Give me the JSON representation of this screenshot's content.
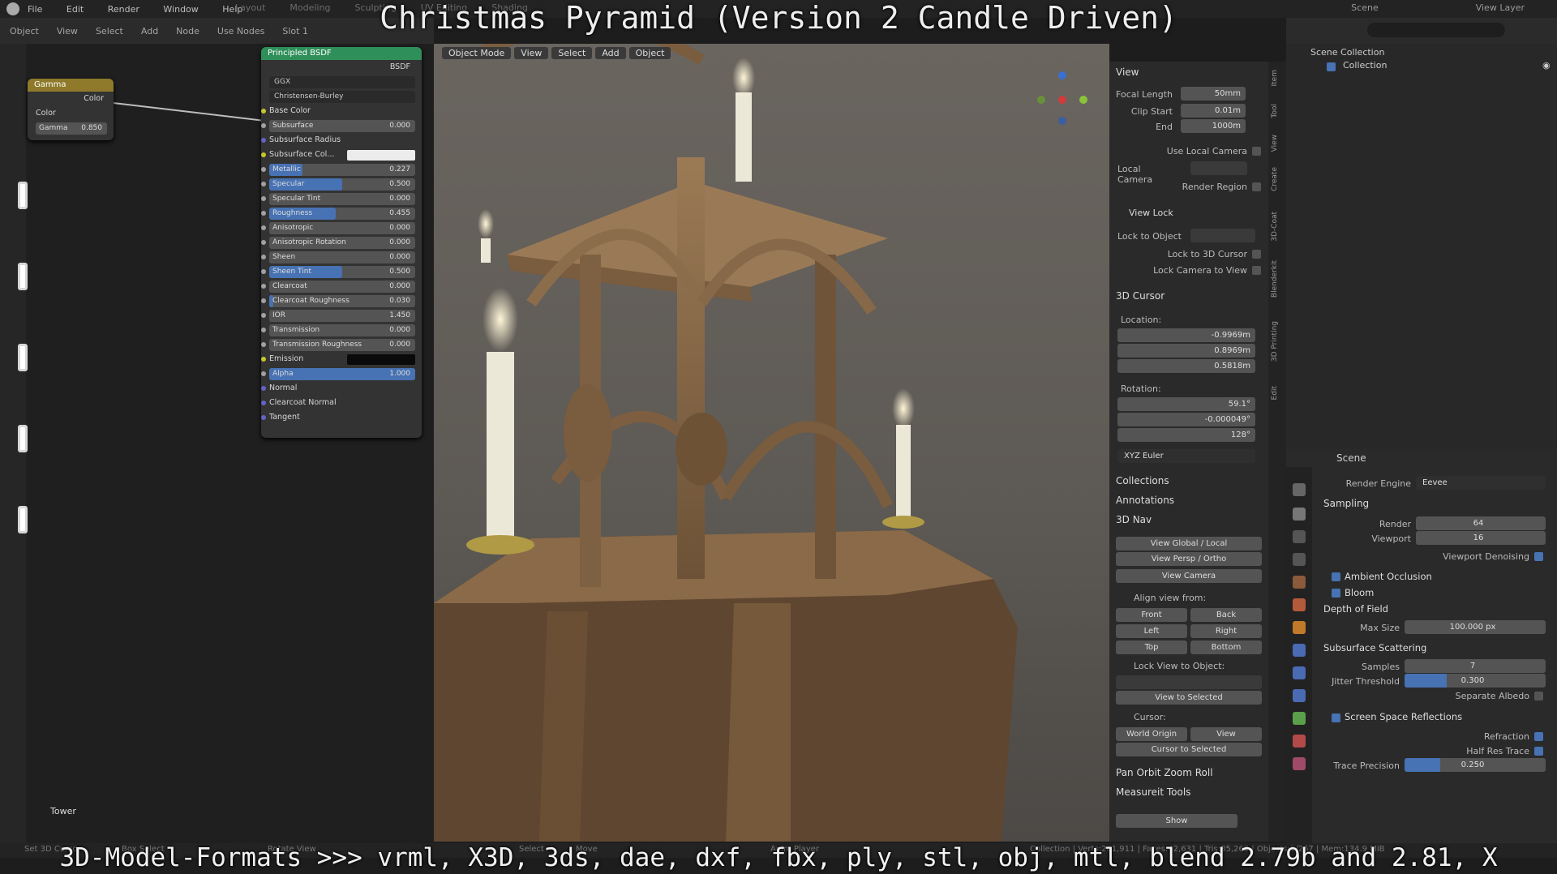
{
  "title_overlay": "Christmas Pyramid (Version 2 Candle Driven)",
  "subtitle_overlay": "3D-Model-Formats >>> vrml, X3D, 3ds, dae, dxf, fbx, ply, stl, obj, mtl, blend 2.79b and 2.81, X",
  "topbar": {
    "menu": [
      "File",
      "Edit",
      "Render",
      "Window",
      "Help"
    ],
    "workspaces": [
      "Layout",
      "Modeling",
      "Sculpting",
      "UV Editing",
      "Shading"
    ],
    "scene": "Scene",
    "view_layer": "View Layer"
  },
  "node_header": {
    "items": [
      "Object",
      "View",
      "Select",
      "Add",
      "Node"
    ],
    "use_nodes": "Use Nodes",
    "slot": "Slot 1"
  },
  "gamma_node": {
    "title": "Gamma",
    "out_label": "Color",
    "in_label": "Color",
    "field_label": "Gamma",
    "field_value": "0.850"
  },
  "bsdf_node": {
    "title": "Principled BSDF",
    "output": "BSDF",
    "distribution": "GGX",
    "subsurface_method": "Christensen-Burley",
    "rows": [
      {
        "label": "Base Color",
        "value": "",
        "kind": "plain",
        "sock": "yellow"
      },
      {
        "label": "Subsurface",
        "value": "0.000",
        "kind": "slider",
        "fill": 0,
        "sock": "grey"
      },
      {
        "label": "Subsurface Radius",
        "value": "",
        "kind": "dropdown",
        "sock": "blue"
      },
      {
        "label": "Subsurface Col...",
        "value": "",
        "kind": "color",
        "color": "#ececec",
        "sock": "yellow"
      },
      {
        "label": "Metallic",
        "value": "0.227",
        "kind": "slider",
        "fill": 0.227,
        "sock": "grey"
      },
      {
        "label": "Specular",
        "value": "0.500",
        "kind": "slider",
        "fill": 0.5,
        "sock": "grey"
      },
      {
        "label": "Specular Tint",
        "value": "0.000",
        "kind": "slider",
        "fill": 0,
        "sock": "grey"
      },
      {
        "label": "Roughness",
        "value": "0.455",
        "kind": "slider",
        "fill": 0.455,
        "sock": "grey"
      },
      {
        "label": "Anisotropic",
        "value": "0.000",
        "kind": "slider",
        "fill": 0,
        "sock": "grey"
      },
      {
        "label": "Anisotropic Rotation",
        "value": "0.000",
        "kind": "slider",
        "fill": 0,
        "sock": "grey"
      },
      {
        "label": "Sheen",
        "value": "0.000",
        "kind": "slider",
        "fill": 0,
        "sock": "grey"
      },
      {
        "label": "Sheen Tint",
        "value": "0.500",
        "kind": "slider",
        "fill": 0.5,
        "sock": "grey"
      },
      {
        "label": "Clearcoat",
        "value": "0.000",
        "kind": "slider",
        "fill": 0,
        "sock": "grey"
      },
      {
        "label": "Clearcoat Roughness",
        "value": "0.030",
        "kind": "slider",
        "fill": 0.03,
        "sock": "grey"
      },
      {
        "label": "IOR",
        "value": "1.450",
        "kind": "slider",
        "fill": 0,
        "sock": "grey"
      },
      {
        "label": "Transmission",
        "value": "0.000",
        "kind": "slider",
        "fill": 0,
        "sock": "grey"
      },
      {
        "label": "Transmission Roughness",
        "value": "0.000",
        "kind": "slider",
        "fill": 0,
        "sock": "grey"
      },
      {
        "label": "Emission",
        "value": "",
        "kind": "color",
        "color": "#0a0a0a",
        "sock": "yellow"
      },
      {
        "label": "Alpha",
        "value": "1.000",
        "kind": "slider",
        "fill": 1,
        "sock": "grey"
      },
      {
        "label": "Normal",
        "value": "",
        "kind": "plain",
        "sock": "blue"
      },
      {
        "label": "Clearcoat Normal",
        "value": "",
        "kind": "plain",
        "sock": "blue"
      },
      {
        "label": "Tangent",
        "value": "",
        "kind": "plain",
        "sock": "blue"
      }
    ]
  },
  "tower_label": "Tower",
  "viewport_header": [
    "Object Mode",
    "View",
    "Select",
    "Add",
    "Object"
  ],
  "npanel": {
    "view_title": "View",
    "focal_label": "Focal Length",
    "focal_value": "50mm",
    "clip_start_label": "Clip Start",
    "clip_start_value": "0.01m",
    "end_label": "End",
    "end_value": "1000m",
    "use_local_camera": "Use Local Camera",
    "local_camera": "Local Camera",
    "render_region": "Render Region",
    "view_lock_title": "View Lock",
    "lock_to_object": "Lock to Object",
    "lock_to_cursor": "Lock to 3D Cursor",
    "lock_camera": "Lock Camera to View",
    "cursor_title": "3D Cursor",
    "location_label": "Location:",
    "loc_x": "-0.9969m",
    "loc_y": "0.8969m",
    "loc_z": "0.5818m",
    "rotation_label": "Rotation:",
    "rot_x": "59.1°",
    "rot_y": "-0.000049°",
    "rot_z": "128°",
    "rot_mode": "XYZ Euler",
    "collections": "Collections",
    "annotations": "Annotations",
    "nav_title": "3D Nav",
    "view_global_local": "View Global / Local",
    "view_persp_ortho": "View Persp / Ortho",
    "view_camera": "View Camera",
    "align_view": "Align view from:",
    "front": "Front",
    "back": "Back",
    "left": "Left",
    "right": "Right",
    "top": "Top",
    "bottom": "Bottom",
    "lock_view": "Lock View to Object:",
    "view_selected": "View to Selected",
    "cursor_label": "Cursor:",
    "world_origin": "World Origin",
    "view": "View",
    "cursor_selected": "Cursor to Selected",
    "pan_orbit": "Pan Orbit Zoom Roll",
    "measureit": "Measureit Tools",
    "show": "Show",
    "tabs": [
      "Item",
      "Tool",
      "View",
      "Create",
      "3D-Coat",
      "Blenderkit",
      "3D Printing",
      "Edit"
    ]
  },
  "outliner": {
    "scene_collection": "Scene Collection",
    "collection": "Collection"
  },
  "properties": {
    "scene": "Scene",
    "render_engine_label": "Render Engine",
    "render_engine": "Eevee",
    "sampling": "Sampling",
    "render_label": "Render",
    "render_value": "64",
    "viewport_label": "Viewport",
    "viewport_value": "16",
    "viewport_denoising": "Viewport Denoising",
    "ambient_occlusion": "Ambient Occlusion",
    "bloom": "Bloom",
    "depth_of_field": "Depth of Field",
    "max_size_label": "Max Size",
    "max_size_value": "100.000 px",
    "sss": "Subsurface Scattering",
    "samples_label": "Samples",
    "samples_value": "7",
    "jitter_label": "Jitter Threshold",
    "jitter_value": "0.300",
    "jitter_fill": 0.3,
    "separate_albedo": "Separate Albedo",
    "ssr": "Screen Space Reflections",
    "refraction": "Refraction",
    "half_res": "Half Res Trace",
    "trace_precision_label": "Trace Precision",
    "trace_precision_value": "0.250",
    "trace_fill": 0.25
  },
  "statusbar": {
    "left1": "Set 3D Cursor",
    "left2": "Box Select",
    "left3": "Rotate View",
    "mid1": "Select",
    "mid2": "Move",
    "mid3": "Anim Player",
    "right": "Collection | Verts:201,911 | Faces:42,631 | Tris:85,262 | Objects:1/267 | Mem:134.9 MiB"
  },
  "colors": {
    "accent": "#4772b3",
    "bsdf_header": "#2f8f5a",
    "gamma_header": "#8e7a2a"
  }
}
